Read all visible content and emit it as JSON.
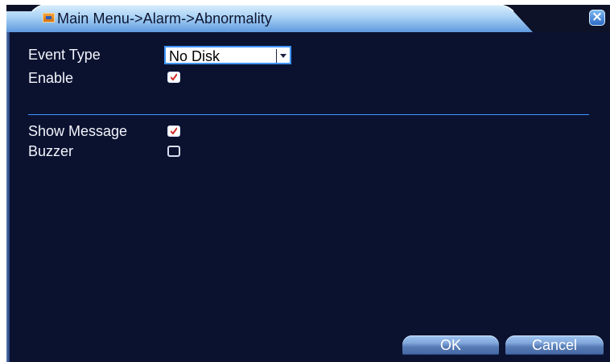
{
  "window": {
    "title": "Main Menu->Alarm->Abnormality"
  },
  "form": {
    "event_type": {
      "label": "Event Type",
      "value": "No Disk"
    },
    "enable": {
      "label": "Enable",
      "checked": true
    },
    "show_message": {
      "label": "Show Message",
      "checked": true
    },
    "buzzer": {
      "label": "Buzzer",
      "checked": false
    }
  },
  "buttons": {
    "ok": "OK",
    "cancel": "Cancel"
  },
  "colors": {
    "background": "#0b1230",
    "accent": "#3f95ff",
    "checkmark": "#d12b2b"
  }
}
